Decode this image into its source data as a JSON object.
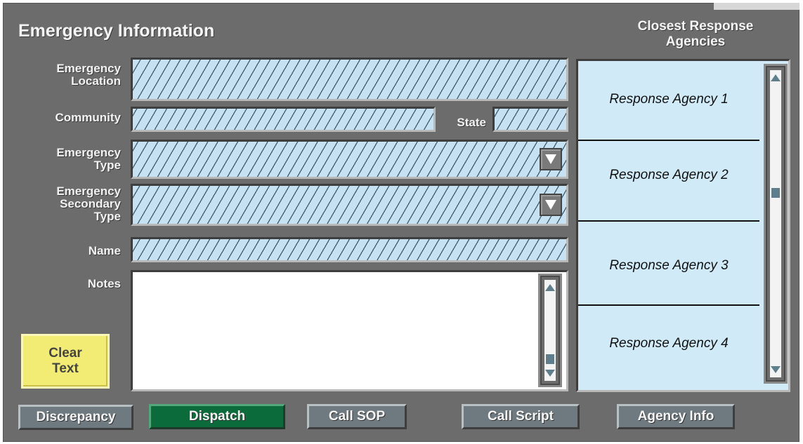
{
  "header": {
    "title": "Emergency Information",
    "agencies_title": "Closest Response\nAgencies"
  },
  "form": {
    "emergency_location_label": "Emergency\nLocation",
    "community_label": "Community",
    "state_label": "State",
    "emergency_type_label": "Emergency\nType",
    "secondary_type_label": "Emergency\nSecondary\nType",
    "name_label": "Name",
    "notes_label": "Notes"
  },
  "agencies": [
    {
      "label": "Response Agency 1"
    },
    {
      "label": "Response Agency 2"
    },
    {
      "label": "Response Agency 3"
    },
    {
      "label": "Response Agency 4"
    }
  ],
  "buttons": {
    "clear_text": "Clear\nText",
    "discrepancy": "Discrepancy",
    "dispatch": "Dispatch",
    "call_sop": "Call SOP",
    "call_script": "Call Script",
    "agency_info": "Agency Info"
  },
  "colors": {
    "panel_bg": "#6c6c6c",
    "field_bg": "#c6e2f2",
    "dispatch_bg": "#0b6b3a",
    "clear_bg": "#f3ec74"
  }
}
